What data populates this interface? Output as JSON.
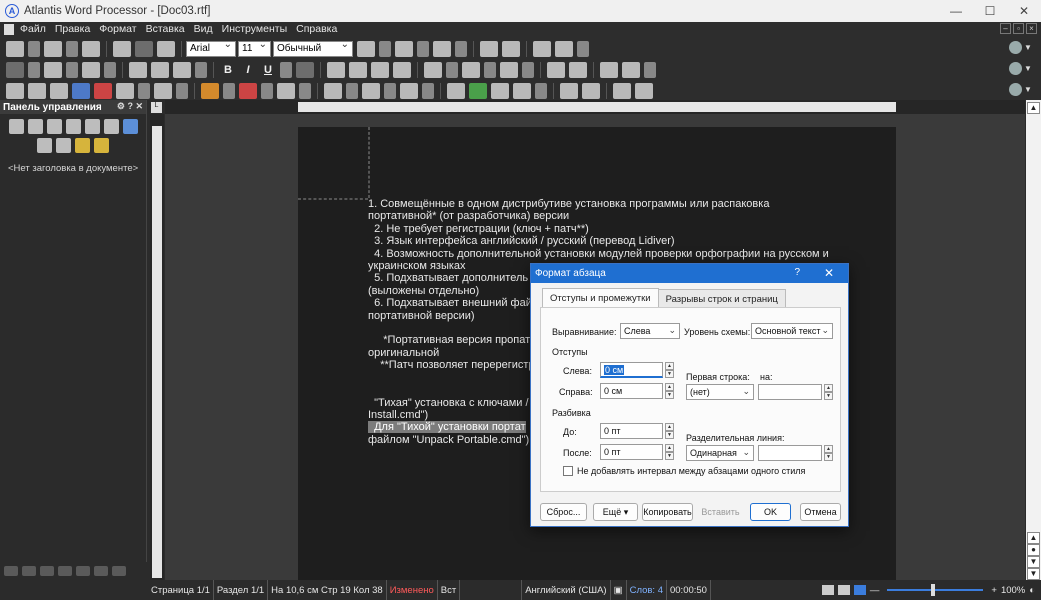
{
  "window": {
    "title": "Atlantis Word Processor - [Doc03.rtf]",
    "logo_letter": "A",
    "controls": {
      "minimize": "—",
      "maximize": "☐",
      "close": "✕"
    }
  },
  "menu": {
    "items": [
      "Файл",
      "Правка",
      "Формат",
      "Вставка",
      "Вид",
      "Инструменты",
      "Справка"
    ]
  },
  "toolbar": {
    "font_name": "Arial",
    "font_size": "11",
    "style_name": "Обычный",
    "bold": "B",
    "italic": "I",
    "underline": "U"
  },
  "side_panel": {
    "title": "Панель управления",
    "controls": "⚙ ? ✕",
    "empty_text": "<Нет заголовка в документе>"
  },
  "document": {
    "lines": [
      "1. Совмещённые в одном дистрибутиве установка программы или распаковка",
      "портативной* (от разработчика) версии",
      "  2. Не требует регистрации (ключ + патч**)",
      "  3. Язык интерфейса английский / русский (перевод Lidiver)",
      "  4. Возможность дополнительной установки модулей проверки орфографии на русском и",
      "украинском языках",
      "  5. Подхватывает дополнитель",
      "(выложены отдельно)",
      "  6. Подхватывает внешний фай",
      "портативной версии)",
      "",
      "     *Портативная версия пропат",
      "оригинальной",
      "    **Патч позволяет перерегистр",
      "",
      "",
      "  \"Тихая\" установка с ключами /",
      "Install.cmd\")"
    ],
    "selected_line": "  Для \"Тихой\" установки портат",
    "last_line": "файлом \"Unpack Portable.cmd\")"
  },
  "status": {
    "page": "Страница 1/1",
    "section": "Раздел 1/1",
    "position": "На 10,6 см  Стр 19  Кол 38",
    "modified": "Изменено",
    "insert": "Вст",
    "language": "Английский (США)",
    "words": "Слов: 4",
    "time": "00:00:50",
    "zoom": "100%"
  },
  "dialog": {
    "title": "Формат абзаца",
    "help": "?",
    "close": "✕",
    "tabs": [
      "Отступы и промежутки",
      "Разрывы строк и страниц"
    ],
    "alignment_label": "Выравнивание:",
    "alignment_value": "Слева",
    "outline_label": "Уровень схемы:",
    "outline_value": "Основной текст",
    "indents_group": "Отступы",
    "left_label": "Слева:",
    "left_value": "0 см",
    "right_label": "Справа:",
    "right_value": "0 см",
    "first_line_label": "Первая строка:",
    "first_line_value": "(нет)",
    "by_label": "на:",
    "by_value": "",
    "spacing_group": "Разбивка",
    "before_label": "До:",
    "before_value": "0 пт",
    "after_label": "После:",
    "after_value": "0 пт",
    "line_spacing_label": "Разделительная линия:",
    "line_spacing_value": "Одинарная",
    "line_spacing_at": "",
    "no_space_checkbox": "Не добавлять интервал между абзацами одного стиля",
    "buttons": {
      "reset": "Сброс...",
      "more": "Ещё ▾",
      "copy": "Копировать",
      "paste": "Вставить",
      "ok": "OK",
      "cancel": "Отмена"
    }
  },
  "colors": {
    "accent": "#1f6fd1",
    "modified": "#ff5a5a",
    "words": "#7fb2ff"
  }
}
